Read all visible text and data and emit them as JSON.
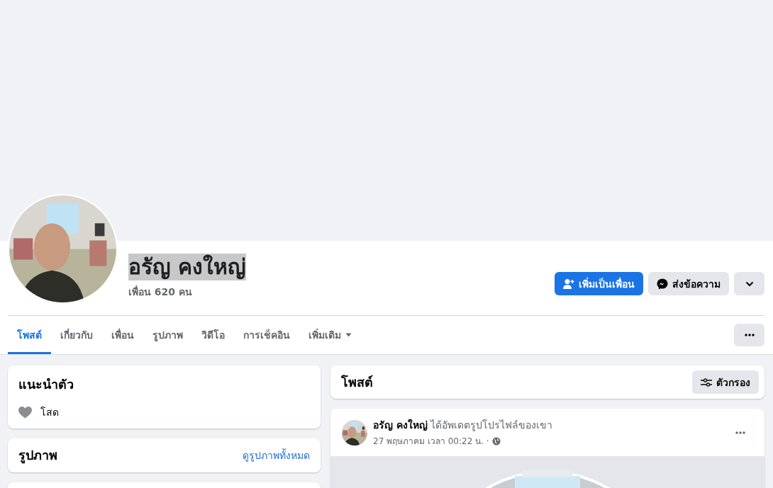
{
  "profile": {
    "name": "อรัญ คงใหญ่",
    "name_selected": true,
    "friends": "เพื่อน 620 คน"
  },
  "actions": [
    {
      "kind": "add-friend",
      "label": "เพิ่มเป็นเพื่อน"
    },
    {
      "kind": "message",
      "label": "ส่งข้อความ"
    },
    {
      "kind": "menu"
    }
  ],
  "tabs": [
    {
      "label": "โพสต์",
      "selected": true
    },
    {
      "label": "เกี่ยวกับ",
      "selected": false
    },
    {
      "label": "เพื่อน",
      "selected": false
    },
    {
      "label": "รูปภาพ",
      "selected": false
    },
    {
      "label": "วิดีโอ",
      "selected": false
    },
    {
      "label": "การเช็คอิน",
      "selected": false
    },
    {
      "label": "เพิ่มเติม",
      "selected": false,
      "kind": "dropdown"
    }
  ],
  "intro": {
    "title": "แนะนำตัว",
    "items": [
      {
        "kind": "relationship",
        "text": "โสด"
      }
    ]
  },
  "photos": {
    "title": "รูปภาพ",
    "link": "ดูรูปภาพทั้งหมด"
  },
  "posts": {
    "title": "โพสต์",
    "filter": "ตัวกรอง"
  },
  "post": {
    "headline": "**อรัญ คงใหญ่** ได้อัพเดตรูปโปรไฟล์ของเขา",
    "time": "27 พฤษภาคม เวลา 00:22 น. ·",
    "kind": "picture"
  }
}
